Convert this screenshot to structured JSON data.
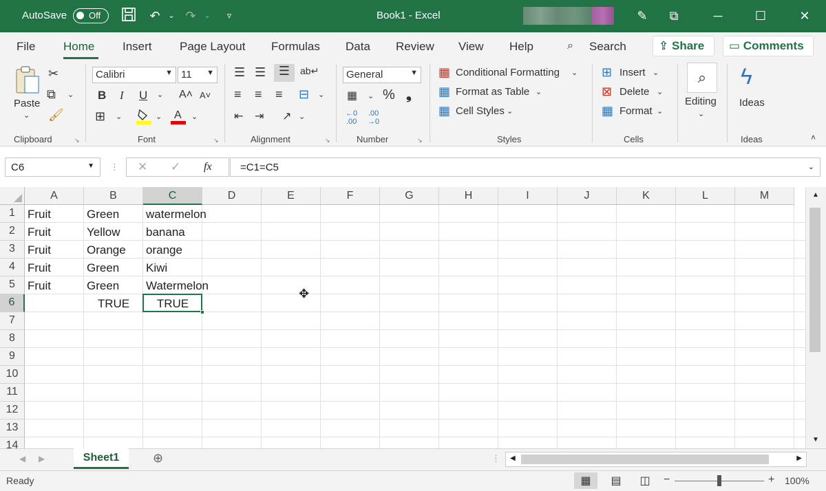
{
  "title_bar": {
    "autosave_label": "AutoSave",
    "autosave_state": "Off",
    "title": "Book1  -  Excel"
  },
  "ribbon_tabs": [
    "File",
    "Home",
    "Insert",
    "Page Layout",
    "Formulas",
    "Data",
    "Review",
    "View",
    "Help"
  ],
  "active_tab": "Home",
  "search_label": "Search",
  "share_label": "Share",
  "comments_label": "Comments",
  "clipboard": {
    "paste_label": "Paste",
    "group_label": "Clipboard"
  },
  "font": {
    "name": "Calibri",
    "size": "11",
    "bold": "B",
    "italic": "I",
    "underline": "U",
    "group_label": "Font"
  },
  "alignment": {
    "group_label": "Alignment"
  },
  "number": {
    "format": "General",
    "group_label": "Number"
  },
  "styles": {
    "conditional_formatting": "Conditional Formatting",
    "format_as_table": "Format as Table",
    "cell_styles": "Cell Styles",
    "group_label": "Styles"
  },
  "cells": {
    "insert": "Insert",
    "delete": "Delete",
    "format": "Format",
    "group_label": "Cells"
  },
  "editing": {
    "label": "Editing"
  },
  "ideas": {
    "label": "Ideas",
    "group_label": "Ideas"
  },
  "formula_bar": {
    "name_box": "C6",
    "fx": "fx",
    "formula": "=C1=C5"
  },
  "columns": [
    "A",
    "B",
    "C",
    "D",
    "E",
    "F",
    "G",
    "H",
    "I",
    "J",
    "K",
    "L",
    "M"
  ],
  "rows": [
    "1",
    "2",
    "3",
    "4",
    "5",
    "6",
    "7",
    "8",
    "9",
    "10",
    "11",
    "12",
    "13",
    "14"
  ],
  "selected_cell": {
    "column": "C",
    "row": "6"
  },
  "cells_data": [
    {
      "row": 1,
      "col": "A",
      "value": "Fruit"
    },
    {
      "row": 1,
      "col": "B",
      "value": "Green"
    },
    {
      "row": 1,
      "col": "C",
      "value": "watermelon"
    },
    {
      "row": 2,
      "col": "A",
      "value": "Fruit"
    },
    {
      "row": 2,
      "col": "B",
      "value": "Yellow"
    },
    {
      "row": 2,
      "col": "C",
      "value": "banana"
    },
    {
      "row": 3,
      "col": "A",
      "value": "Fruit"
    },
    {
      "row": 3,
      "col": "B",
      "value": "Orange"
    },
    {
      "row": 3,
      "col": "C",
      "value": "orange"
    },
    {
      "row": 4,
      "col": "A",
      "value": "Fruit"
    },
    {
      "row": 4,
      "col": "B",
      "value": "Green"
    },
    {
      "row": 4,
      "col": "C",
      "value": "Kiwi"
    },
    {
      "row": 5,
      "col": "A",
      "value": "Fruit"
    },
    {
      "row": 5,
      "col": "B",
      "value": "Green"
    },
    {
      "row": 5,
      "col": "C",
      "value": "Watermelon"
    },
    {
      "row": 6,
      "col": "B",
      "value": "TRUE"
    },
    {
      "row": 6,
      "col": "C",
      "value": "TRUE"
    }
  ],
  "sheet_tab": "Sheet1",
  "status": {
    "ready": "Ready",
    "zoom": "100%",
    "zoom_minus": "−",
    "zoom_plus": "+"
  },
  "colors": {
    "excel_green": "#217346"
  }
}
